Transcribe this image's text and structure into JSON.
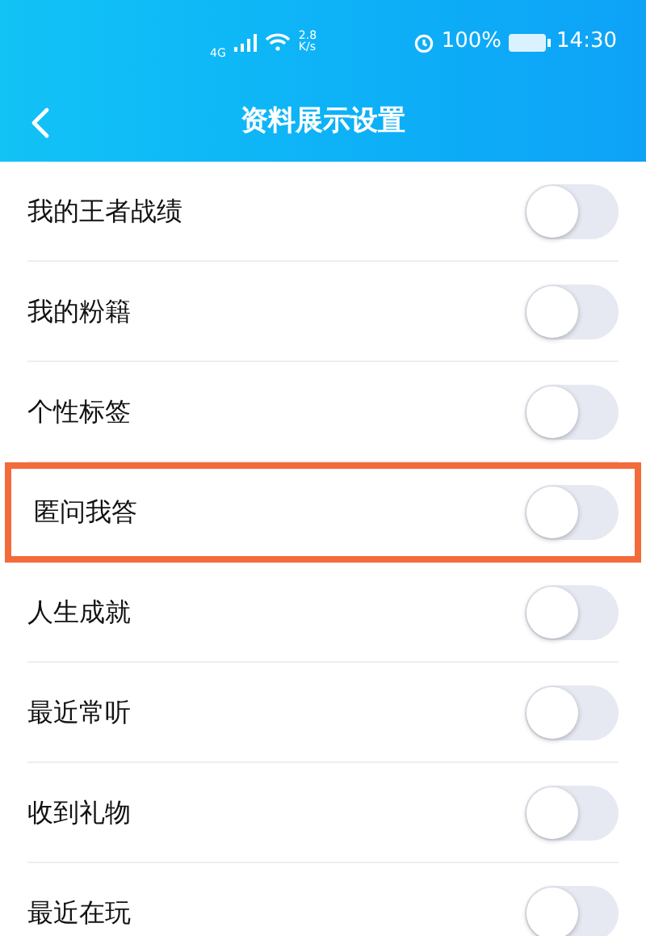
{
  "status_bar": {
    "network": "4G",
    "speed_value": "2.8",
    "speed_unit": "K/s",
    "battery": "100%",
    "time": "14:30"
  },
  "header": {
    "title": "资料展示设置"
  },
  "settings": [
    {
      "label": "我的王者战绩",
      "on": false,
      "highlighted": false
    },
    {
      "label": "我的粉籍",
      "on": false,
      "highlighted": false
    },
    {
      "label": "个性标签",
      "on": false,
      "highlighted": false
    },
    {
      "label": "匿问我答",
      "on": false,
      "highlighted": true
    },
    {
      "label": "人生成就",
      "on": false,
      "highlighted": false
    },
    {
      "label": "最近常听",
      "on": false,
      "highlighted": false
    },
    {
      "label": "收到礼物",
      "on": false,
      "highlighted": false
    },
    {
      "label": "最近在玩",
      "on": false,
      "highlighted": false
    }
  ]
}
